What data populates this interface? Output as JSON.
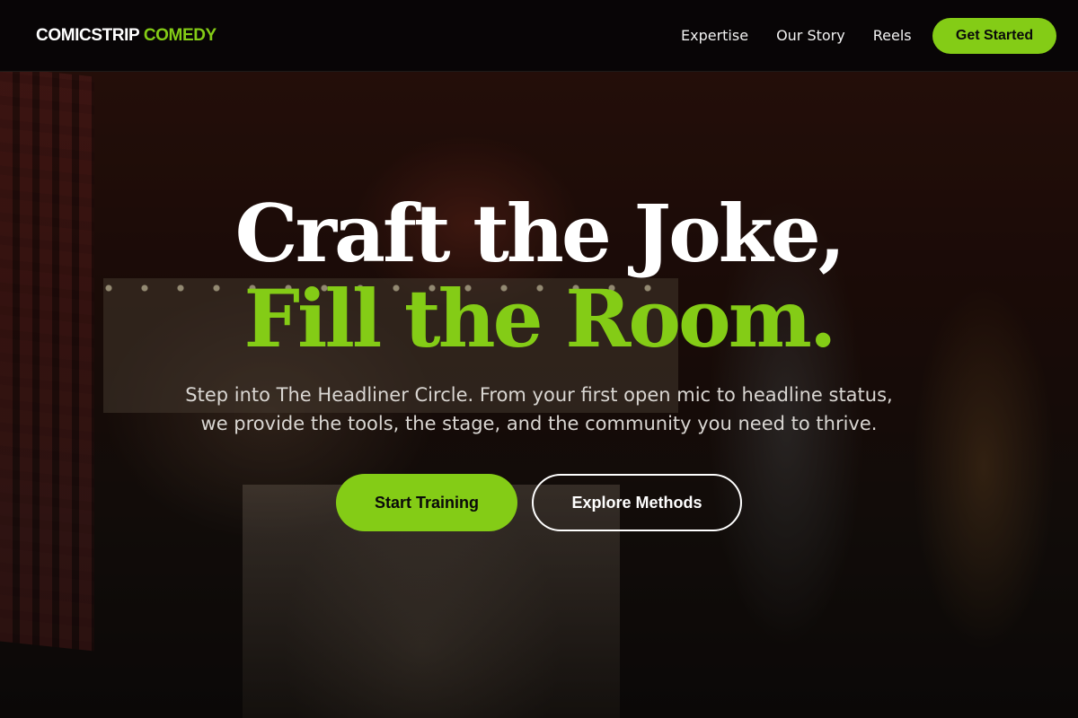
{
  "brand": {
    "name_part1": "COMICSTRIP",
    "name_part2": "COMEDY",
    "accent_color": "#84cc16"
  },
  "nav": {
    "links": [
      "Expertise",
      "Our Story",
      "Reels"
    ],
    "cta_label": "Get Started"
  },
  "hero": {
    "headline_line1": "Craft the Joke,",
    "headline_line2": "Fill the Room.",
    "subtext_line1": "Step into The Headliner Circle. From your first open mic to headline status,",
    "subtext_line2": "we provide the tools, the stage, and the community you need to thrive.",
    "primary_button": "Start Training",
    "secondary_button": "Explore Methods",
    "background_image": "comedy-club-entrance-photo"
  },
  "colors": {
    "nav_background": "#080506",
    "accent": "#84cc16",
    "text_primary": "#ffffff"
  }
}
